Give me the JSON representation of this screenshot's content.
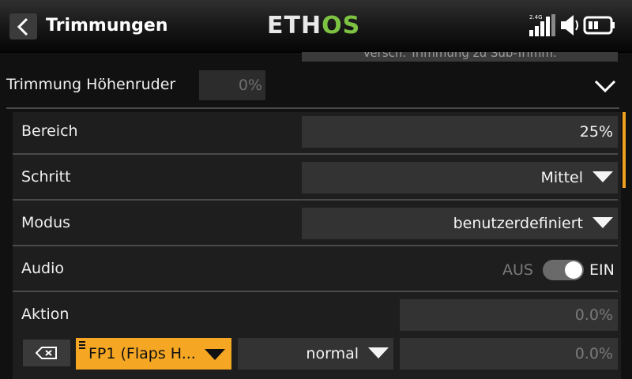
{
  "header": {
    "title": "Trimmungen",
    "logo_left": "ETH",
    "logo_right": "OS",
    "signal_label": "2.4G",
    "colors": {
      "logo_accent": "#7dc242",
      "highlight": "#f5a623"
    }
  },
  "top_button": {
    "label": "Versch. Trimmung zu Sub-Trimm."
  },
  "group": {
    "title": "Trimmung Höhenruder",
    "value": "0%",
    "chevron_icon": "chevron-down-icon"
  },
  "rows": {
    "bereich": {
      "label": "Bereich",
      "value": "25%"
    },
    "schritt": {
      "label": "Schritt",
      "value": "Mittel"
    },
    "modus": {
      "label": "Modus",
      "value": "benutzerdefiniert"
    },
    "audio": {
      "label": "Audio",
      "off_label": "AUS",
      "on_label": "EIN",
      "state": "on"
    },
    "aktion": {
      "label": "Aktion",
      "value1": "0.0%",
      "source": "FP1 (Flaps H...",
      "mode": "normal",
      "value2": "0.0%",
      "clear_icon": "backspace-icon"
    }
  }
}
